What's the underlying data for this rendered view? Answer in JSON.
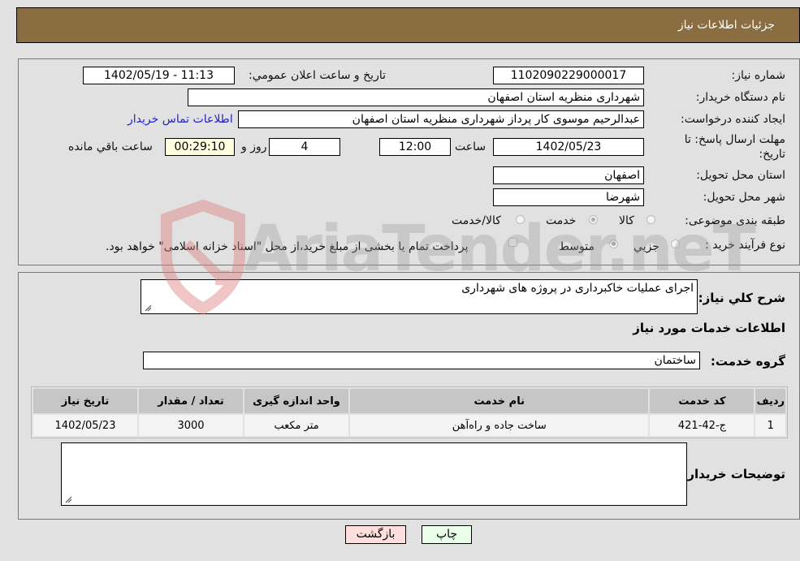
{
  "header": {
    "title": "جزئیات اطلاعات نیاز"
  },
  "fields": {
    "need_number": {
      "label": "شماره نیاز:",
      "value": "1102090229000017"
    },
    "announce_datetime": {
      "label": "تاريخ و ساعت اعلان عمومي:",
      "value": "1402/05/19 - 11:13"
    },
    "buyer_org": {
      "label": "نام دستگاه خریدار:",
      "value": "شهرداری منظریه استان اصفهان"
    },
    "requester": {
      "label": "ایجاد کننده درخواست:",
      "value": "عبدالرحیم موسوی کار پرداز  شهرداری منظریه استان اصفهان"
    },
    "buyer_contact_link": "اطلاعات تماس خریدار",
    "deadline": {
      "label_line1": "مهلت ارسال پاسخ: تا",
      "label_line2": "تاریخ:",
      "date": "1402/05/23",
      "time_label": "ساعت",
      "time": "12:00",
      "days": "4",
      "days_label": "روز و",
      "remaining": "00:29:10",
      "remaining_label": "ساعت باقي مانده"
    },
    "province": {
      "label": "استان محل تحویل:",
      "value": "اصفهان"
    },
    "city": {
      "label": "شهر محل تحویل:",
      "value": "شهرضا"
    },
    "category": {
      "label": "طبقه بندی موضوعی:",
      "options": [
        "کالا",
        "خدمت",
        "کالا/خدمت"
      ],
      "selected": "خدمت"
    },
    "process_type": {
      "label": "نوع فرآیند خرید :",
      "options": [
        "جزيي",
        "متوسط"
      ],
      "selected": "متوسط",
      "treasury_note": "پرداخت تمام یا بخشی از مبلغ خرید،از محل \"اسناد خزانه اسلامی\" خواهد بود."
    }
  },
  "description": {
    "label": "شرح کلي نياز:",
    "value": "اجرای عملیات خاکبرداری در پروژه های شهرداری"
  },
  "services_section_title": "اطلاعات خدمات مورد نیاز",
  "service_group": {
    "label": "گروه خدمت:",
    "value": "ساختمان"
  },
  "table": {
    "headers": [
      "رديف",
      "کد خدمت",
      "نام خدمت",
      "واحد اندازه گیری",
      "تعداد / مقدار",
      "تاریخ نیاز"
    ],
    "rows": [
      [
        "1",
        "ج-42-421",
        "ساخت جاده و راه‌آهن",
        "متر مکعب",
        "3000",
        "1402/05/23"
      ]
    ]
  },
  "buyer_notes": {
    "label": "توضیحات خریدار:",
    "value": ""
  },
  "buttons": {
    "print": "چاپ",
    "back": "بازگشت"
  },
  "watermark": "AriaTender.neT",
  "colors": {
    "header_bg": "#8b6d42",
    "print_bg": "#eaffea",
    "back_bg": "#ffdede",
    "link": "#2222cc"
  }
}
